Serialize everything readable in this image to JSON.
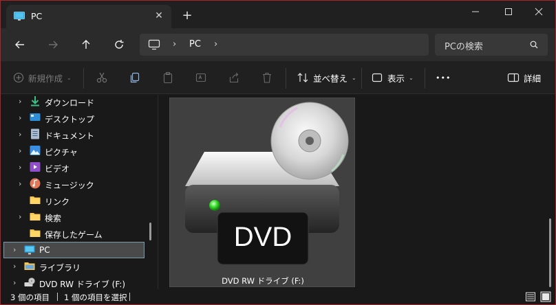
{
  "tab": {
    "title": "PC",
    "close_glyph": "✕",
    "new_tab_glyph": "+"
  },
  "address": {
    "segments": [
      "PC"
    ],
    "separator": "›"
  },
  "search": {
    "placeholder": "PCの検索"
  },
  "toolbar": {
    "new_label": "新規作成",
    "sort_label": "並べ替え",
    "view_label": "表示",
    "more_label": "•••",
    "details_label": "詳細",
    "chevron": "⌄"
  },
  "nav": {
    "chevron": "›",
    "items": [
      {
        "label": "ダウンロード",
        "icon": "download-icon"
      },
      {
        "label": "デスクトップ",
        "icon": "desktop-icon"
      },
      {
        "label": "ドキュメント",
        "icon": "document-icon"
      },
      {
        "label": "ピクチャ",
        "icon": "pictures-icon"
      },
      {
        "label": "ビデオ",
        "icon": "video-icon"
      },
      {
        "label": "ミュージック",
        "icon": "music-icon"
      },
      {
        "label": "リンク",
        "icon": "folder-icon"
      },
      {
        "label": "検索",
        "icon": "folder-icon"
      },
      {
        "label": "保存したゲーム",
        "icon": "folder-icon"
      },
      {
        "label": "PC",
        "icon": "pc-icon",
        "selected": true
      },
      {
        "label": "ライブラリ",
        "icon": "library-icon"
      },
      {
        "label": "DVD RW ドライブ (F:)",
        "icon": "dvd-drive-icon"
      }
    ]
  },
  "content": {
    "drive_label": "DVD RW ドライブ (F:)",
    "drive_badge": "DVD"
  },
  "status": {
    "item_count": "3 個の項目",
    "selected_count": "1 個の項目を選択"
  },
  "colors": {
    "accent_border": "#a8252a",
    "selection": "#4a4a4a",
    "folder": "#f5c451"
  }
}
